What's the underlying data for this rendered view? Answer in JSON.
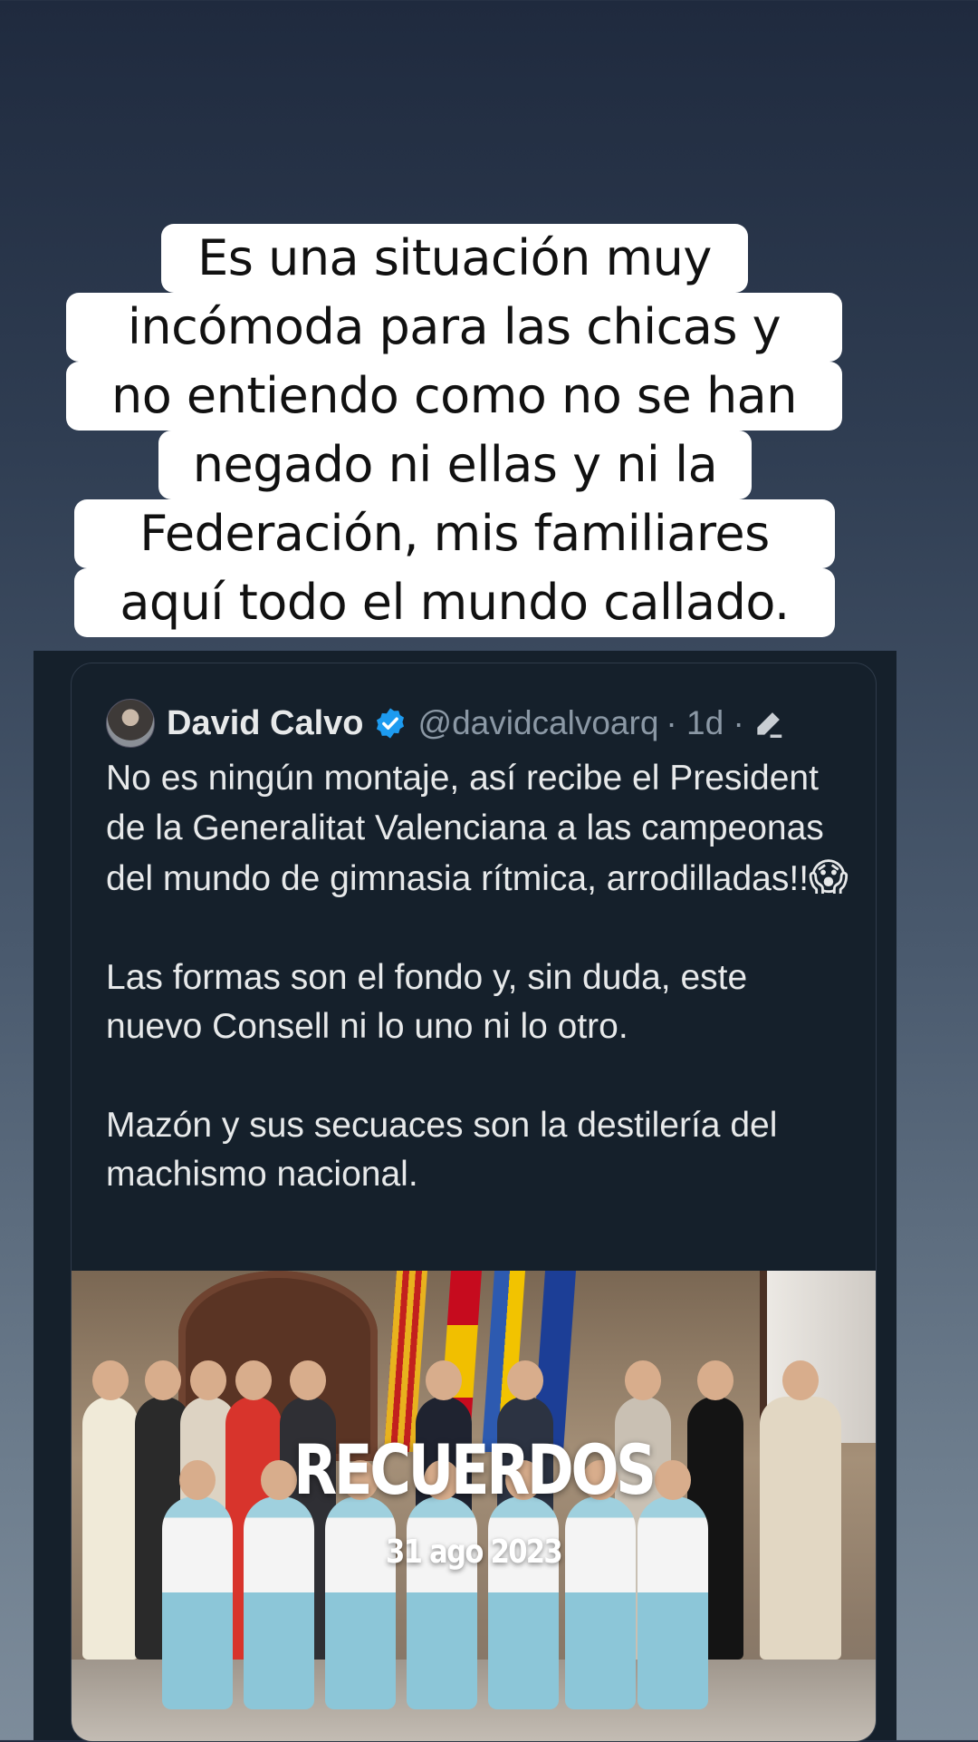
{
  "caption": {
    "lines": [
      "Es una situación muy",
      "incómoda para las chicas y",
      "no entiendo como no se han",
      "negado ni ellas y ni la",
      "Federación, mis familiares",
      "aquí todo el mundo callado."
    ]
  },
  "tweet": {
    "author": "David Calvo",
    "handle": "@davidcalvoarq",
    "time": "· 1d ·",
    "paragraphs": [
      "No es ningún montaje, así recibe el President de la Generalitat Valenciana a las campeonas del mundo de gimnasia rítmica, arrodilladas!!",
      "Las formas son el fondo y, sin duda, este nuevo Consell ni lo uno ni lo otro.",
      "Mazón y sus secuaces son la destilería del machismo nacional."
    ],
    "emoji": "😱",
    "verified_color": "#1d9bf0"
  },
  "photo_overlay": {
    "title": "RECUERDOS",
    "date": "31 ago 2023"
  },
  "colors": {
    "tweet_background": "#15202b",
    "tweet_text": "#e7e9ea",
    "tweet_muted": "#8b98a5"
  }
}
